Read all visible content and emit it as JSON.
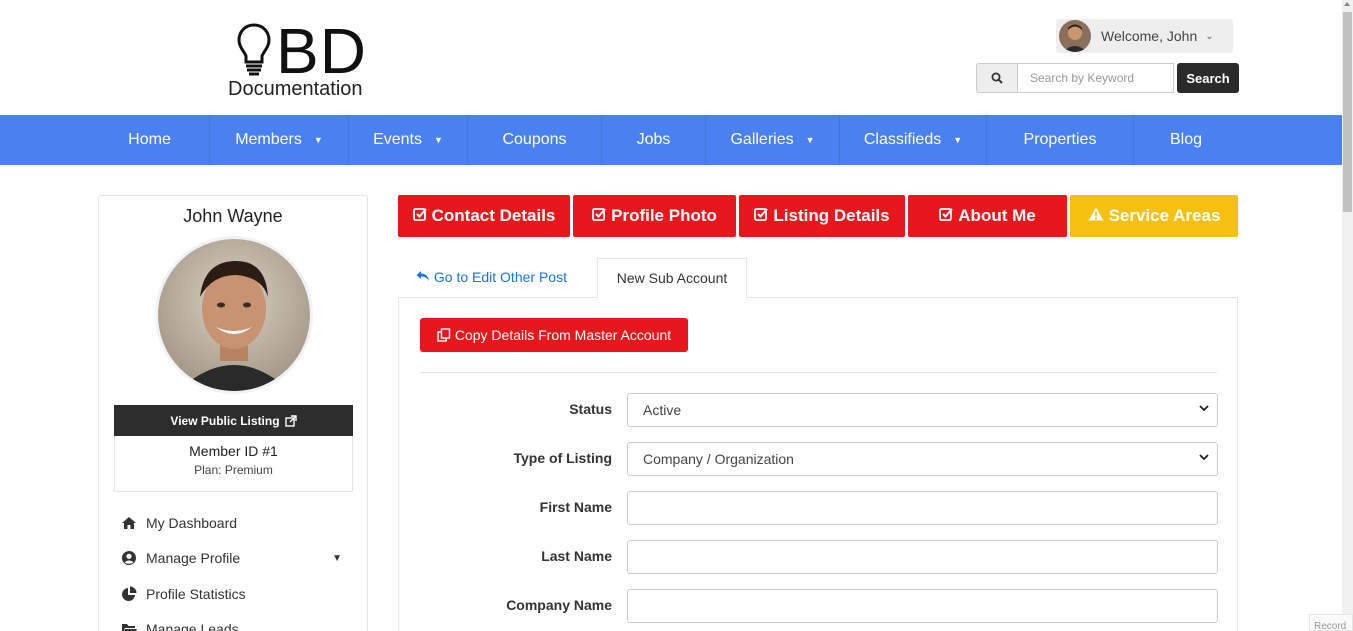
{
  "header": {
    "logo_main": "BD",
    "logo_sub": "Documentation",
    "welcome": "Welcome, John",
    "search_placeholder": "Search by Keyword",
    "search_button": "Search"
  },
  "nav": {
    "items": [
      {
        "label": "Home",
        "caret": false
      },
      {
        "label": "Members",
        "caret": true
      },
      {
        "label": "Events",
        "caret": true
      },
      {
        "label": "Coupons",
        "caret": false
      },
      {
        "label": "Jobs",
        "caret": false
      },
      {
        "label": "Galleries",
        "caret": true
      },
      {
        "label": "Classifieds",
        "caret": true
      },
      {
        "label": "Properties",
        "caret": false
      },
      {
        "label": "Blog",
        "caret": false
      }
    ]
  },
  "profile": {
    "name": "John Wayne",
    "view_public": "View Public Listing",
    "member_id": "Member ID #1",
    "plan": "Plan: Premium"
  },
  "side_menu": [
    {
      "label": "My Dashboard",
      "icon": "home-icon"
    },
    {
      "label": "Manage Profile",
      "icon": "user-circle-icon"
    },
    {
      "label": "Profile Statistics",
      "icon": "pie-chart-icon"
    },
    {
      "label": "Manage Leads",
      "icon": "folder-icon"
    }
  ],
  "tabs": [
    {
      "label": "Contact Details",
      "icon": "check-square-icon",
      "color": "#e8171c"
    },
    {
      "label": "Profile Photo",
      "icon": "check-square-icon",
      "color": "#e8171c"
    },
    {
      "label": "Listing Details",
      "icon": "check-square-icon",
      "color": "#e8171c"
    },
    {
      "label": "About Me",
      "icon": "check-square-icon",
      "color": "#e8171c"
    },
    {
      "label": "Service Areas",
      "icon": "warning-icon",
      "color": "#f5c00f"
    }
  ],
  "subtabs": {
    "back_link": "Go to Edit Other Post",
    "active": "New Sub Account"
  },
  "form": {
    "copy_button": "Copy Details From Master Account",
    "status_label": "Status",
    "status_value": "Active",
    "listing_type_label": "Type of Listing",
    "listing_type_value": "Company / Organization",
    "first_name_label": "First Name",
    "first_name_value": "",
    "last_name_label": "Last Name",
    "last_name_value": "",
    "company_name_label": "Company Name",
    "company_name_value": ""
  },
  "recorder_label": "Record",
  "colors": {
    "nav": "#4a80ef",
    "primary_red": "#e8171c",
    "warning_yellow": "#f5c00f",
    "link_blue": "#1a73d9"
  }
}
